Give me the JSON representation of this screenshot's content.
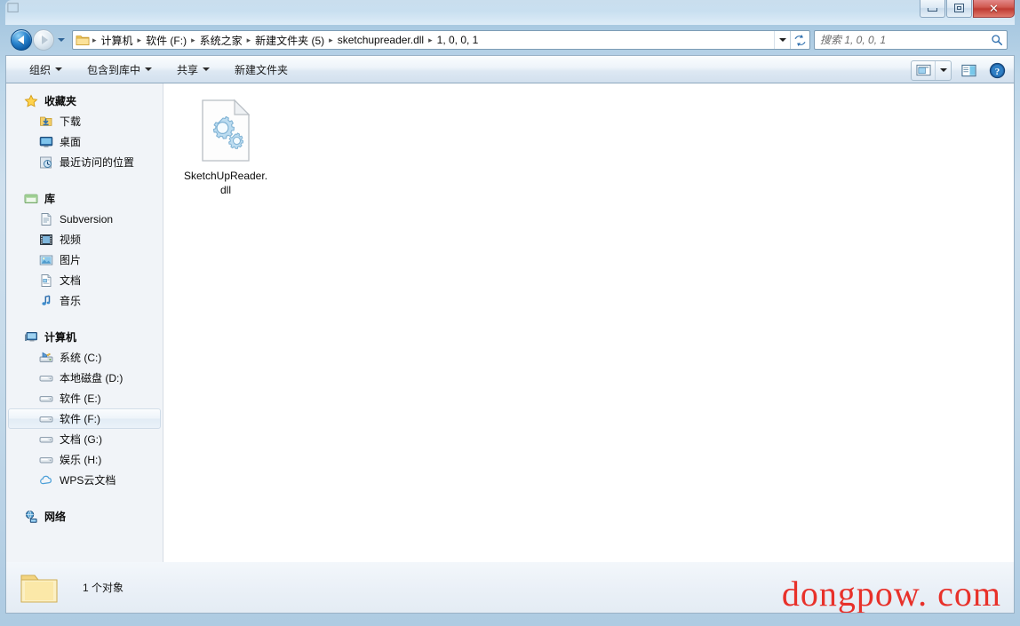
{
  "window": {
    "title": "",
    "buttons": {
      "minimize": "minimize-button",
      "restore": "restore-button",
      "close": "close-button"
    }
  },
  "navigation": {
    "back_tooltip": "后退",
    "forward_tooltip": "前进",
    "history_tooltip": "最近访问的位置",
    "refresh_tooltip": "刷新"
  },
  "address_bar": {
    "breadcrumbs": [
      "计算机",
      "软件 (F:)",
      "系统之家",
      "新建文件夹 (5)",
      "sketchupreader.dll",
      "1, 0, 0, 1"
    ],
    "separator": "▸"
  },
  "search": {
    "placeholder": "搜索 1, 0, 0, 1",
    "value": ""
  },
  "command_bar": {
    "items": [
      {
        "label": "组织",
        "has_caret": true
      },
      {
        "label": "包含到库中",
        "has_caret": true
      },
      {
        "label": "共享",
        "has_caret": true
      },
      {
        "label": "新建文件夹",
        "has_caret": false
      }
    ],
    "right_buttons": [
      {
        "name": "change-view-button"
      },
      {
        "name": "view-dropdown-button"
      },
      {
        "name": "preview-pane-button"
      },
      {
        "name": "help-button"
      }
    ]
  },
  "sidebar": {
    "groups": [
      {
        "header": {
          "label": "收藏夹",
          "icon": "star-icon"
        },
        "items": [
          {
            "label": "下载",
            "icon": "download-folder-icon",
            "selected": false
          },
          {
            "label": "桌面",
            "icon": "desktop-icon",
            "selected": false
          },
          {
            "label": "最近访问的位置",
            "icon": "recent-places-icon",
            "selected": false
          }
        ]
      },
      {
        "header": {
          "label": "库",
          "icon": "library-icon"
        },
        "items": [
          {
            "label": "Subversion",
            "icon": "subversion-library-icon",
            "selected": false
          },
          {
            "label": "视频",
            "icon": "videos-library-icon",
            "selected": false
          },
          {
            "label": "图片",
            "icon": "pictures-library-icon",
            "selected": false
          },
          {
            "label": "文档",
            "icon": "documents-library-icon",
            "selected": false
          },
          {
            "label": "音乐",
            "icon": "music-library-icon",
            "selected": false
          }
        ]
      },
      {
        "header": {
          "label": "计算机",
          "icon": "computer-icon"
        },
        "items": [
          {
            "label": "系统 (C:)",
            "icon": "system-drive-icon",
            "selected": false
          },
          {
            "label": "本地磁盘 (D:)",
            "icon": "drive-icon",
            "selected": false
          },
          {
            "label": "软件 (E:)",
            "icon": "drive-icon",
            "selected": false
          },
          {
            "label": "软件 (F:)",
            "icon": "drive-icon",
            "selected": true
          },
          {
            "label": "文档 (G:)",
            "icon": "drive-icon",
            "selected": false
          },
          {
            "label": "娱乐 (H:)",
            "icon": "drive-icon",
            "selected": false
          },
          {
            "label": "WPS云文档",
            "icon": "cloud-icon",
            "selected": false
          }
        ]
      },
      {
        "header": {
          "label": "网络",
          "icon": "network-icon"
        },
        "items": []
      }
    ]
  },
  "content": {
    "files": [
      {
        "name": "SketchUpReader.dll",
        "icon": "dll-file-icon",
        "selected": false
      }
    ]
  },
  "status_bar": {
    "item_count_text": "1 个对象",
    "folder_icon": "folder-icon"
  },
  "watermark": {
    "text": "dongpow. com",
    "color": "#e8312a"
  },
  "colors": {
    "window_frame": "#aecbe2",
    "command_bar": "#e8f0f8",
    "sidebar_bg": "#f1f4f8",
    "content_bg": "#ffffff",
    "selection": "#eef4fa",
    "close_button": "#bf3b32"
  }
}
